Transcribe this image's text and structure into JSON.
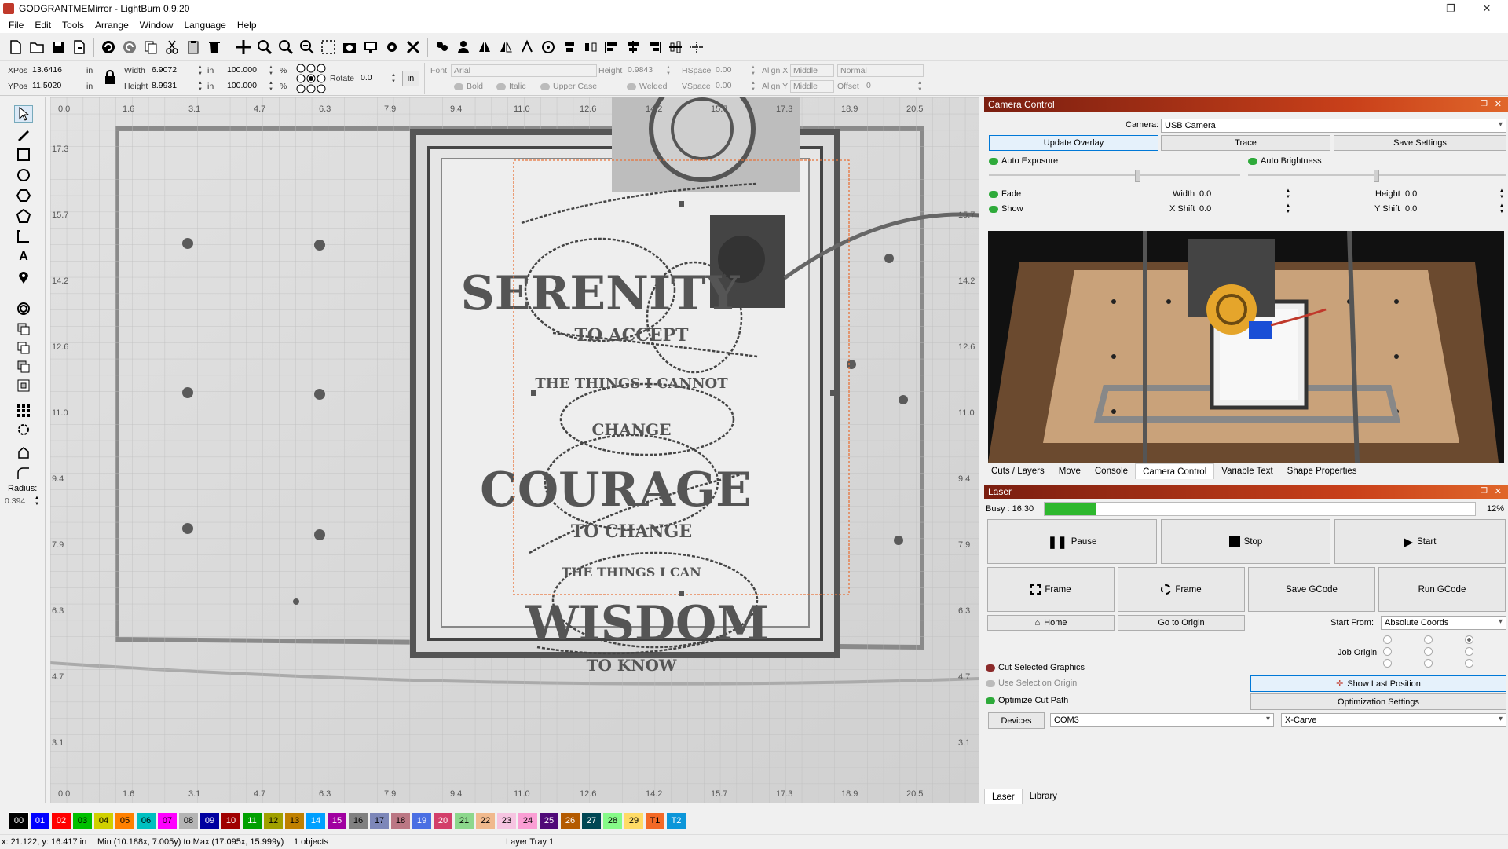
{
  "window": {
    "title": "GODGRANTMEMirror - LightBurn 0.9.20"
  },
  "menu": [
    "File",
    "Edit",
    "Tools",
    "Arrange",
    "Window",
    "Language",
    "Help"
  ],
  "props": {
    "xpos_label": "XPos",
    "xpos": "13.6416",
    "ypos_label": "YPos",
    "ypos": "11.5020",
    "unit": "in",
    "width_label": "Width",
    "width": "6.9072",
    "height_label": "Height",
    "height": "8.9931",
    "scale_w": "100.000",
    "scale_h": "100.000",
    "pct": "%",
    "rotate_label": "Rotate",
    "rotate": "0.0",
    "in_btn": "in",
    "font_label": "Font",
    "font": "Arial",
    "fheight_label": "Height",
    "fheight": "0.9843",
    "hspace_label": "HSpace",
    "hspace": "0.00",
    "vspace_label": "VSpace",
    "vspace": "0.00",
    "alignx_label": "Align X",
    "alignx": "Middle",
    "aligny_label": "Align Y",
    "aligny": "Middle",
    "normal": "Normal",
    "offset_label": "Offset",
    "offset": "0",
    "bold": "Bold",
    "italic": "Italic",
    "upper": "Upper Case",
    "welded": "Welded"
  },
  "left_tools": {
    "radius_label": "Radius:",
    "radius": "0.394"
  },
  "ruler": {
    "x": [
      "0.0",
      "1.6",
      "3.1",
      "4.7",
      "6.3",
      "7.9",
      "9.4",
      "11.0",
      "12.6",
      "14.2",
      "15.7",
      "17.3",
      "18.9",
      "20.5"
    ],
    "y_left": [
      "17.3",
      "15.7",
      "14.2",
      "12.6",
      "11.0",
      "9.4",
      "7.9",
      "6.3",
      "4.7",
      "3.1"
    ],
    "y_right": [
      "15.7",
      "14.2",
      "12.6",
      "11.0",
      "9.4",
      "7.9",
      "6.3",
      "4.7",
      "3.1"
    ],
    "origin_bottom": "0.0"
  },
  "camera": {
    "panel_title": "Camera Control",
    "camera_label": "Camera:",
    "camera_value": "USB Camera",
    "update_overlay": "Update Overlay",
    "trace": "Trace",
    "save_settings": "Save Settings",
    "auto_exposure": "Auto Exposure",
    "auto_brightness": "Auto Brightness",
    "fade": "Fade",
    "show": "Show",
    "width_label": "Width",
    "width": "0.0",
    "height_label": "Height",
    "height": "0.0",
    "xshift_label": "X Shift",
    "xshift": "0.0",
    "yshift_label": "Y Shift",
    "yshift": "0.0"
  },
  "tabs": [
    "Cuts / Layers",
    "Move",
    "Console",
    "Camera Control",
    "Variable Text",
    "Shape Properties"
  ],
  "laser": {
    "panel_title": "Laser",
    "busy": "Busy : 16:30",
    "progress_pct": "12%",
    "progress": 0.12,
    "pause": "Pause",
    "stop": "Stop",
    "start": "Start",
    "frame1": "Frame",
    "frame2": "Frame",
    "save_gcode": "Save GCode",
    "run_gcode": "Run GCode",
    "home": "Home",
    "go_origin": "Go to Origin",
    "start_from_label": "Start From:",
    "start_from": "Absolute Coords",
    "job_origin": "Job Origin",
    "cut_selected": "Cut Selected Graphics",
    "use_selection": "Use Selection Origin",
    "optimize_path": "Optimize Cut Path",
    "show_last": "Show Last Position",
    "opt_settings": "Optimization Settings",
    "devices": "Devices",
    "port": "COM3",
    "machine": "X-Carve"
  },
  "bottom_tabs": [
    "Laser",
    "Library"
  ],
  "palette": [
    {
      "l": "00",
      "c": "#000000",
      "t": "#fff"
    },
    {
      "l": "01",
      "c": "#0000ff",
      "t": "#fff"
    },
    {
      "l": "02",
      "c": "#ff0000",
      "t": "#fff"
    },
    {
      "l": "03",
      "c": "#00c000",
      "t": "#000"
    },
    {
      "l": "04",
      "c": "#d0d000",
      "t": "#000"
    },
    {
      "l": "05",
      "c": "#ff8000",
      "t": "#000"
    },
    {
      "l": "06",
      "c": "#00c0c0",
      "t": "#000"
    },
    {
      "l": "07",
      "c": "#ff00ff",
      "t": "#000"
    },
    {
      "l": "08",
      "c": "#b4b4b4",
      "t": "#000"
    },
    {
      "l": "09",
      "c": "#0000a0",
      "t": "#fff"
    },
    {
      "l": "10",
      "c": "#a00000",
      "t": "#fff"
    },
    {
      "l": "11",
      "c": "#00a000",
      "t": "#fff"
    },
    {
      "l": "12",
      "c": "#a0a000",
      "t": "#000"
    },
    {
      "l": "13",
      "c": "#c08000",
      "t": "#000"
    },
    {
      "l": "14",
      "c": "#00a0ff",
      "t": "#fff"
    },
    {
      "l": "15",
      "c": "#a000a0",
      "t": "#fff"
    },
    {
      "l": "16",
      "c": "#808080",
      "t": "#000"
    },
    {
      "l": "17",
      "c": "#7d87b9",
      "t": "#000"
    },
    {
      "l": "18",
      "c": "#bb7784",
      "t": "#000"
    },
    {
      "l": "19",
      "c": "#4a6fe3",
      "t": "#fff"
    },
    {
      "l": "20",
      "c": "#d33f6a",
      "t": "#fff"
    },
    {
      "l": "21",
      "c": "#8cd78c",
      "t": "#000"
    },
    {
      "l": "22",
      "c": "#f0b98d",
      "t": "#000"
    },
    {
      "l": "23",
      "c": "#f6c4e1",
      "t": "#000"
    },
    {
      "l": "24",
      "c": "#fa9ed4",
      "t": "#000"
    },
    {
      "l": "25",
      "c": "#500a78",
      "t": "#fff"
    },
    {
      "l": "26",
      "c": "#b45a00",
      "t": "#fff"
    },
    {
      "l": "27",
      "c": "#004754",
      "t": "#fff"
    },
    {
      "l": "28",
      "c": "#86fa88",
      "t": "#000"
    },
    {
      "l": "29",
      "c": "#ffdb66",
      "t": "#000"
    },
    {
      "l": "T1",
      "c": "#f36926",
      "t": "#000"
    },
    {
      "l": "T2",
      "c": "#0c96d9",
      "t": "#fff"
    }
  ],
  "status": {
    "coords": "x: 21.122, y: 16.417 in",
    "bounds": "Min (10.188x, 7.005y) to Max (17.095x, 15.999y)",
    "objects": "1 objects",
    "layer": "Layer Tray 1"
  }
}
